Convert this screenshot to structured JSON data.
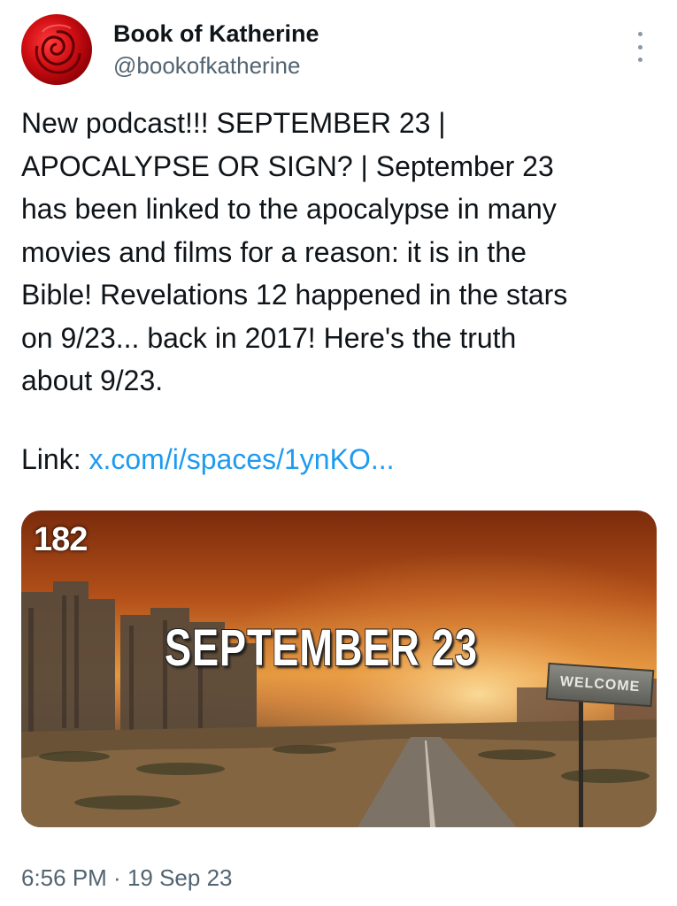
{
  "author": {
    "display_name": "Book of Katherine",
    "handle": "@bookofkatherine",
    "avatar_icon": "rose-avatar"
  },
  "tweet": {
    "text": "New podcast!!! SEPTEMBER 23 |\nAPOCALYPSE OR SIGN? | September 23\nhas been linked to the apocalypse in many\nmovies and films for a reason: it is in the\nBible! Revelations 12 happened in the stars\non 9/23... back in 2017! Here's the truth\nabout 9/23.",
    "link_prefix": "Link: ",
    "link_text": "x.com/i/spaces/1ynKO..."
  },
  "media": {
    "episode_number": "182",
    "title": "SEPTEMBER 23",
    "sign_text": "WELCOME"
  },
  "meta": {
    "time": "6:56 PM",
    "separator": " · ",
    "date": "19 Sep 23"
  },
  "colors": {
    "link": "#1d9bf0",
    "secondary_text": "#536471",
    "primary_text": "#0f1419"
  }
}
